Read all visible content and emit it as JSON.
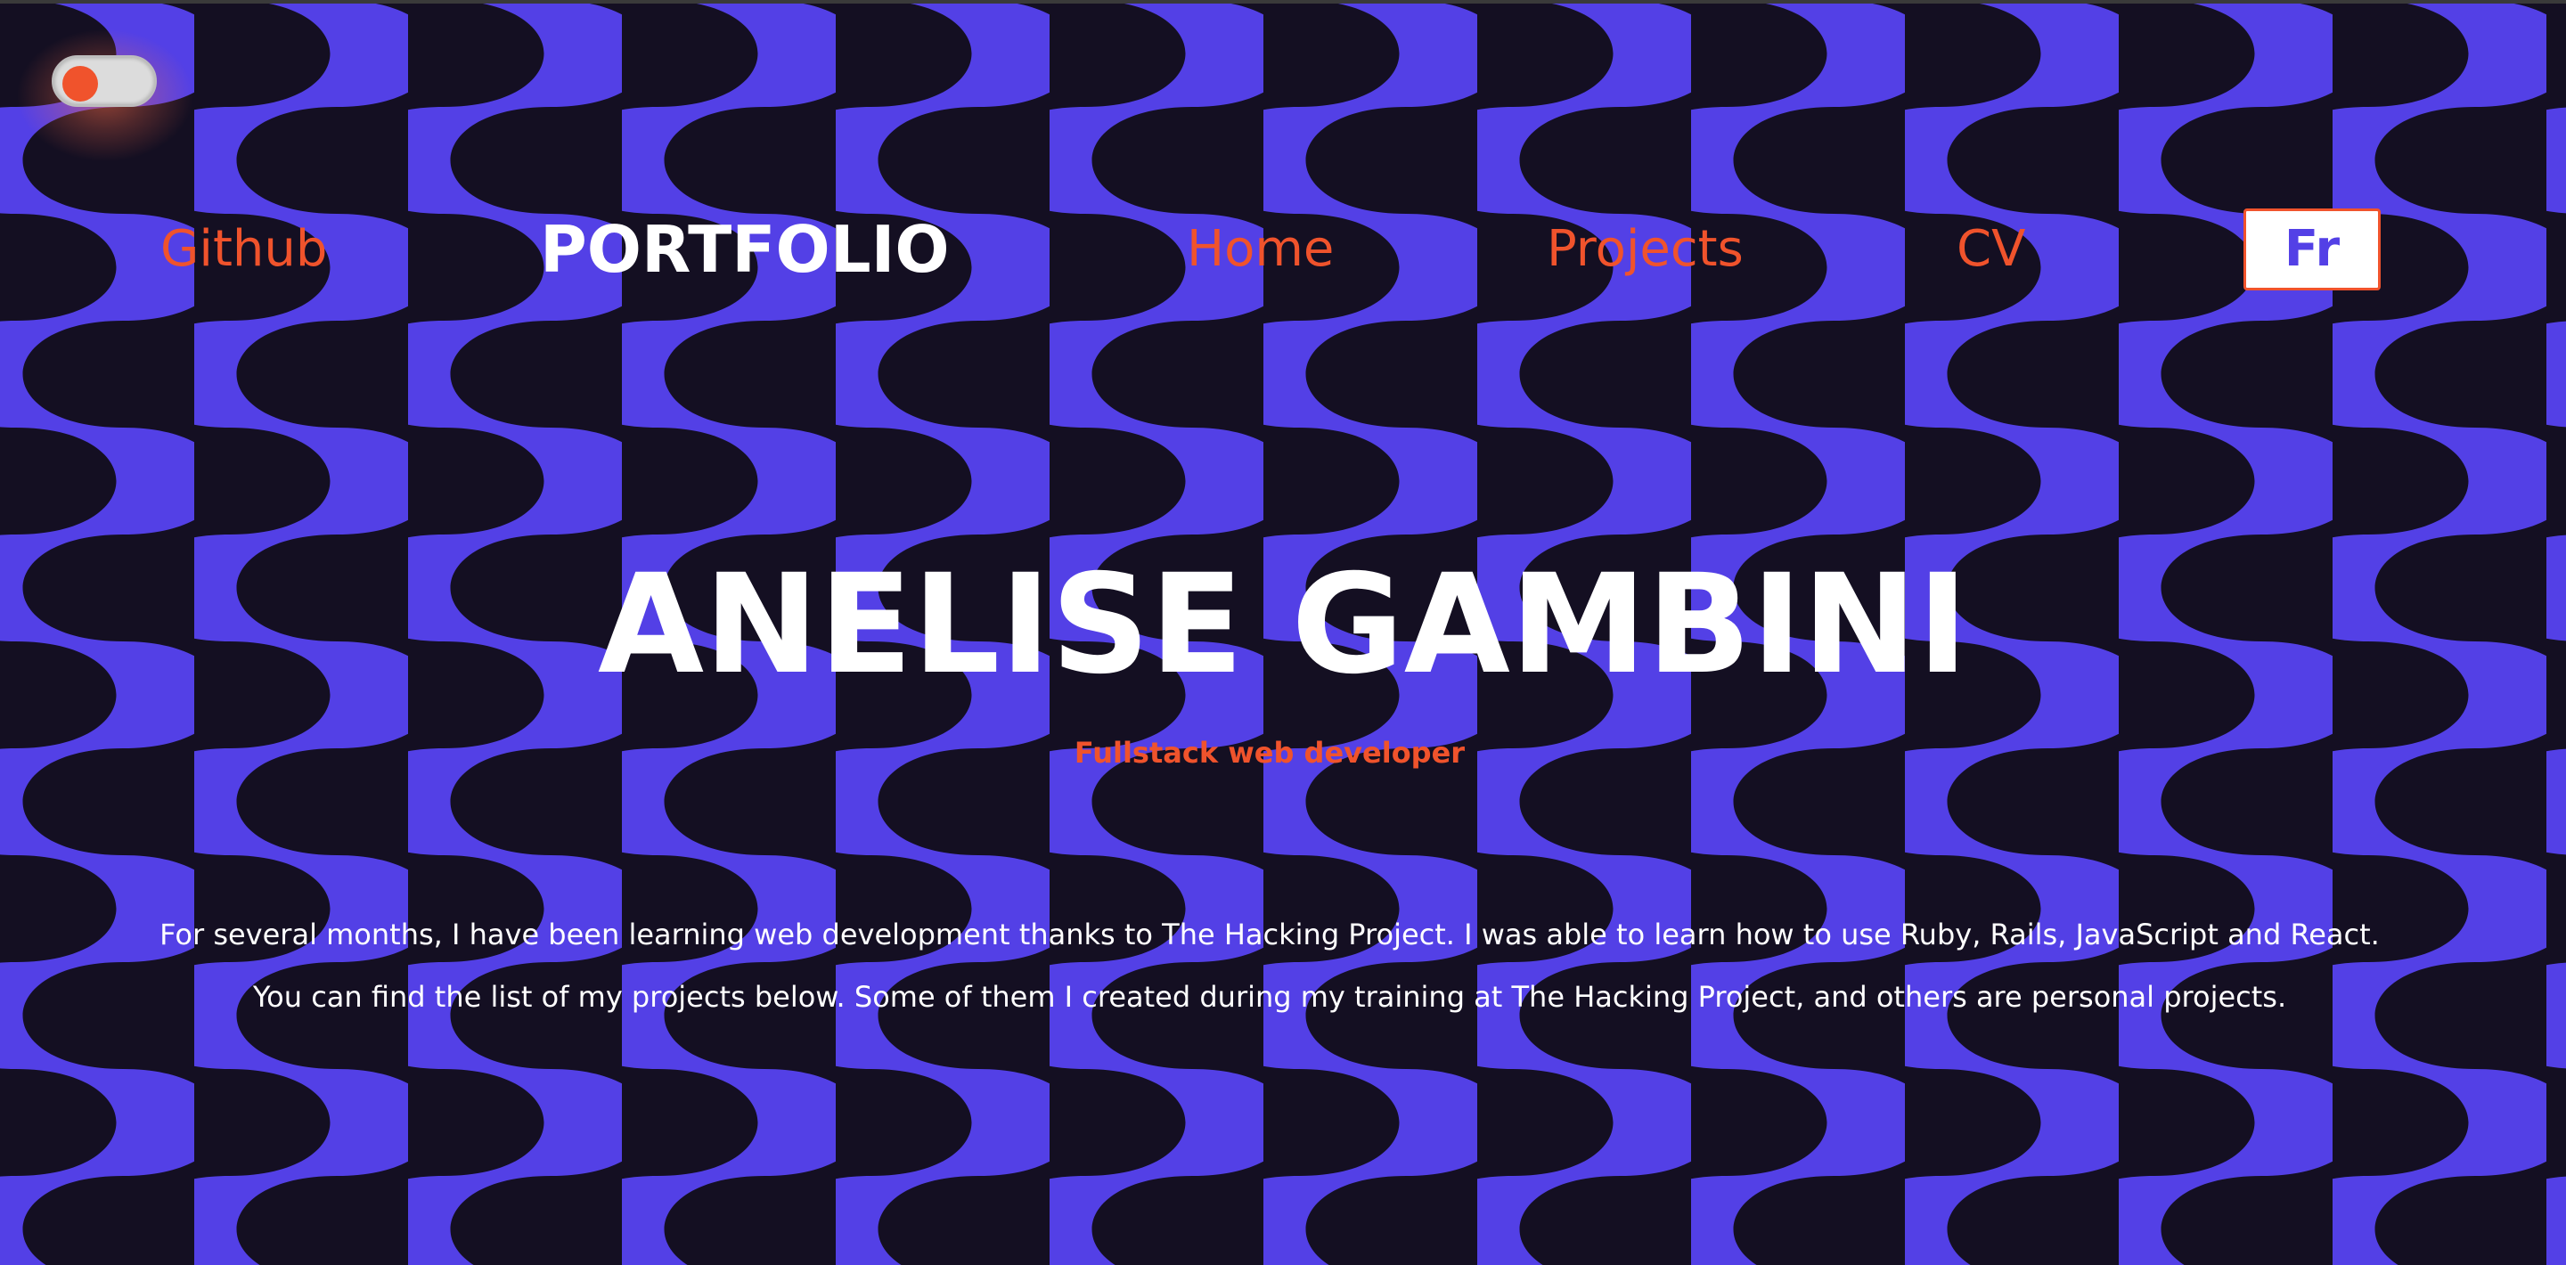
{
  "colors": {
    "accent": "#f0532c",
    "pattern_purple": "#5340e6",
    "pattern_dark": "#140f22",
    "text_light": "#ffffff"
  },
  "toggle": {
    "icon": "theme-toggle",
    "state": "off"
  },
  "nav": {
    "github": "Github",
    "brand": "PORTFOLIO",
    "home": "Home",
    "projects": "Projects",
    "cv": "CV",
    "language_button": "Fr"
  },
  "hero": {
    "name": "ANELISE GAMBINI",
    "subtitle": "Fullstack web developer"
  },
  "intro": {
    "line1": "For several months, I have been learning web development thanks to The Hacking Project. I was able to learn how to use Ruby, Rails, JavaScript and React.",
    "line2": "You can find the list of my projects below. Some of them I created during my training at The Hacking Project, and others are personal projects."
  }
}
